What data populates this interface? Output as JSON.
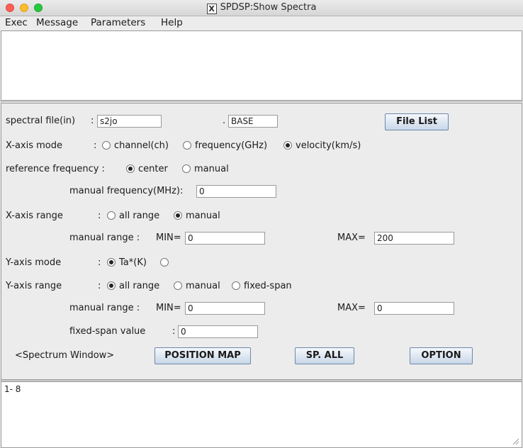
{
  "window": {
    "title": "SPDSP:Show Spectra"
  },
  "menu": [
    "Exec",
    "Message",
    "Parameters",
    "Help"
  ],
  "form": {
    "spectral_file_label": "spectral file(in)",
    "spectral_file_colon": ":",
    "spectral_file_value": "s2jo",
    "dot": ".",
    "extension_value": "BASE",
    "file_list_button": "File List",
    "xaxis_mode_label": "X-axis mode",
    "xaxis_mode_colon": ":",
    "xaxis_mode_options": [
      "channel(ch)",
      "frequency(GHz)",
      "velocity(km/s)"
    ],
    "xaxis_mode_selected": "velocity(km/s)",
    "ref_freq_label": "reference frequency :",
    "ref_freq_options": [
      "center",
      "manual"
    ],
    "ref_freq_selected": "center",
    "manual_freq_label": "manual frequency(MHz):",
    "manual_freq_value": "0",
    "xaxis_range_label": "X-axis range",
    "xaxis_range_colon": ":",
    "xaxis_range_options": [
      "all range",
      "manual"
    ],
    "xaxis_range_selected": "manual",
    "x_manual_range_label": "manual range :",
    "x_min_label": "MIN=",
    "x_min_value": "0",
    "x_max_label": "MAX=",
    "x_max_value": "200",
    "yaxis_mode_label": "Y-axis mode",
    "yaxis_mode_colon": ":",
    "yaxis_mode_options": [
      "Ta*(K)",
      ""
    ],
    "yaxis_mode_selected": "Ta*(K)",
    "yaxis_range_label": "Y-axis range",
    "yaxis_range_colon": ":",
    "yaxis_range_options": [
      "all range",
      "manual",
      "fixed-span"
    ],
    "yaxis_range_selected": "all range",
    "y_manual_range_label": "manual range :",
    "y_min_label": "MIN=",
    "y_min_value": "0",
    "y_max_label": "MAX=",
    "y_max_value": "0",
    "fixed_span_label": "fixed-span value",
    "fixed_span_colon": ":",
    "fixed_span_value": "0",
    "spectrum_window_label": "<Spectrum Window>",
    "position_map_button": "POSITION MAP",
    "sp_all_button": "SP. ALL",
    "option_button": "OPTION"
  },
  "output": {
    "text": "1- 8"
  },
  "colors": {
    "close": "#fc5f57",
    "minimize": "#fdbc2e",
    "zoom": "#28c840",
    "button_border": "#6d88a8"
  }
}
